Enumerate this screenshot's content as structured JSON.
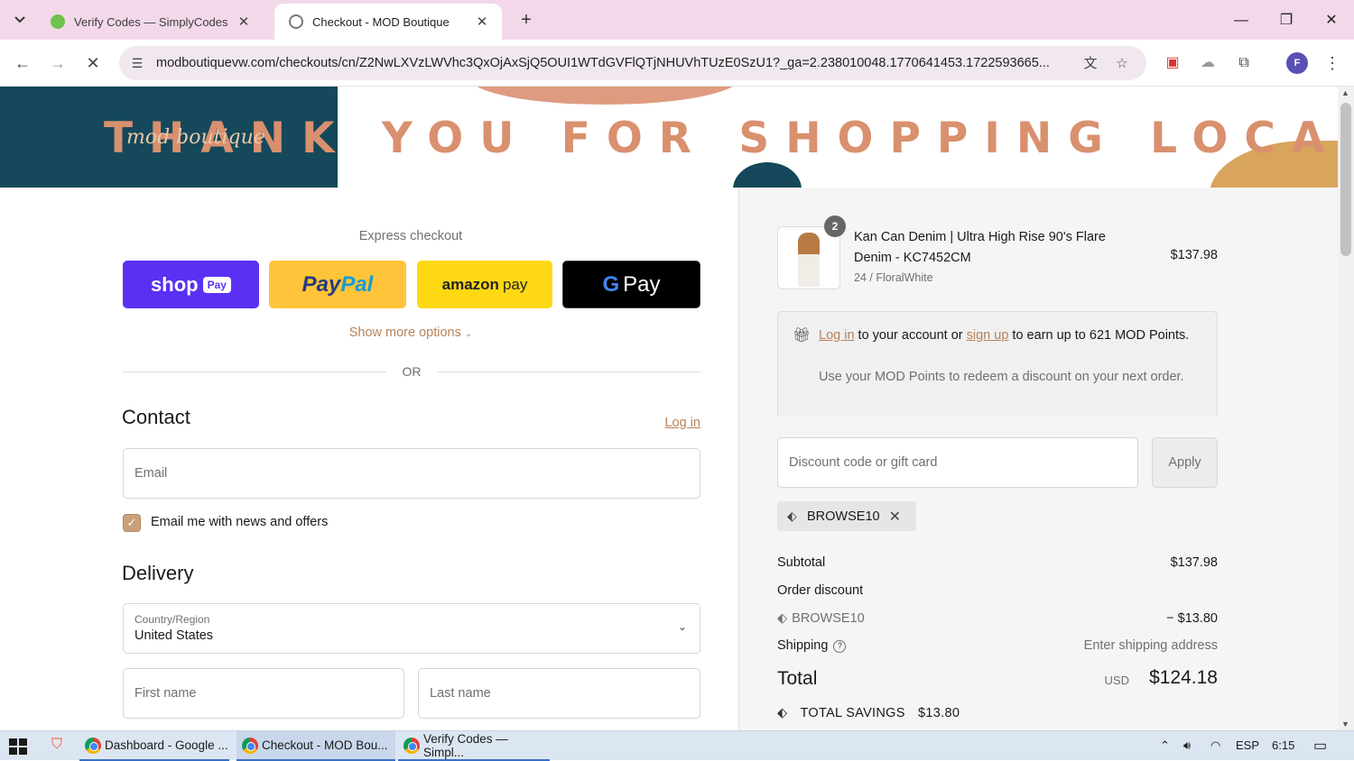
{
  "browser": {
    "tabs": [
      {
        "title": "Verify Codes — SimplyCodes",
        "active": false,
        "favicon_color": "#5cb85c"
      },
      {
        "title": "Checkout - MOD Boutique",
        "active": true,
        "favicon_color": "#888888"
      }
    ],
    "url": "modboutiquevw.com/checkouts/cn/Z2NwLXVzLWVhc3QxOjAxSjQ5OUI1WTdGVFlQTjNHUVhTUzE0SzU1?_ga=2.238010048.1770641453.1722593665...",
    "profile_initial": "F"
  },
  "banner": {
    "text": "THANK YOU FOR SHOPPING LOCAL!",
    "logo": "mod boutique"
  },
  "express": {
    "label": "Express checkout",
    "shop_pay": {
      "word": "shop",
      "pill": "Pay"
    },
    "paypal": {
      "pay": "Pay",
      "pal": "Pal"
    },
    "amazon_pay": {
      "word": "amazon",
      "suffix": "pay"
    },
    "google_pay": {
      "g": "G",
      "word": "Pay"
    },
    "more_options": "Show more options",
    "or": "OR"
  },
  "contact": {
    "heading": "Contact",
    "login_link": "Log in",
    "email_placeholder": "Email",
    "newsletter_label": "Email me with news and offers",
    "newsletter_checked": true
  },
  "delivery": {
    "heading": "Delivery",
    "country_label": "Country/Region",
    "country_value": "United States",
    "first_name_placeholder": "First name",
    "last_name_placeholder": "Last name"
  },
  "order": {
    "quantity": "2",
    "product_name": "Kan Can Denim | Ultra High Rise 90's Flare Denim - KC7452CM",
    "variant": "24 / FloralWhite",
    "price": "$137.98"
  },
  "points": {
    "login_link": "Log in",
    "text_a": " to your account or ",
    "signup_link": "sign up",
    "text_b": " to earn up to 621 MOD Points.",
    "subtext": "Use your MOD Points to redeem a discount on your next order."
  },
  "discount": {
    "placeholder": "Discount code or gift card",
    "apply_label": "Apply",
    "applied_code": "BROWSE10"
  },
  "summary": {
    "subtotal_label": "Subtotal",
    "subtotal_value": "$137.98",
    "order_discount_label": "Order discount",
    "discount_code": "BROWSE10",
    "discount_value": "− $13.80",
    "shipping_label": "Shipping",
    "shipping_value": "Enter shipping address",
    "total_label": "Total",
    "currency": "USD",
    "total_value": "$124.18",
    "savings_label": "TOTAL SAVINGS",
    "savings_value": "$13.80"
  },
  "taskbar": {
    "apps": [
      {
        "title": "Dashboard - Google ...",
        "active": false
      },
      {
        "title": "Checkout - MOD Bou...",
        "active": true
      },
      {
        "title": "Verify Codes — Simpl...",
        "active": false
      }
    ],
    "language": "ESP",
    "time": "6:15"
  },
  "colors": {
    "accent": "#b8825a",
    "shop_pay": "#5a31f4",
    "paypal": "#ffc439",
    "amazon_pay": "#ffd814",
    "tabstrip": "#f3d8ea"
  }
}
